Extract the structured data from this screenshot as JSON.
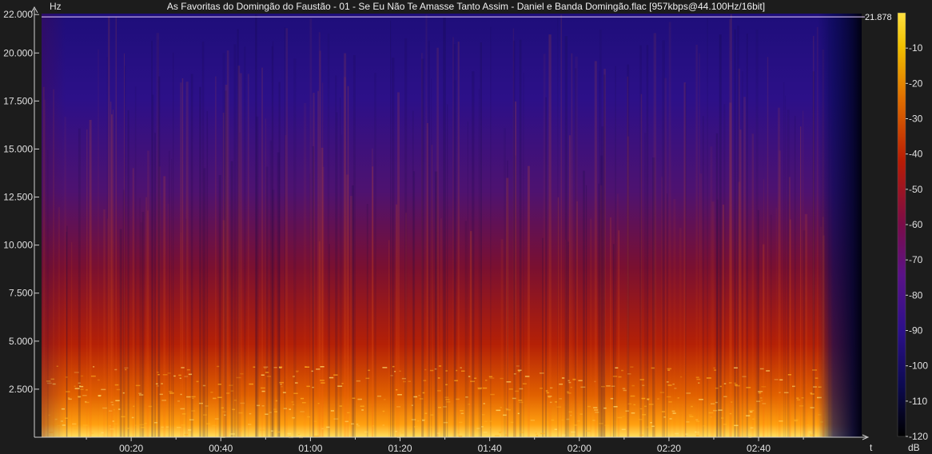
{
  "window": {
    "title": "As Favoritas do Domingão do Faustão - 01 - Se Eu Não Te Amasse Tanto Assim - Daniel e Banda Domingão.flac [957kbps@44.100Hz/16bit]"
  },
  "chart_data": {
    "type": "heatmap",
    "title": "As Favoritas do Domingão do Faustão - 01 - Se Eu Não Te Amasse Tanto Assim - Daniel e Banda Domingão.flac [957kbps@44.100Hz/16bit]",
    "ylabel": "Hz",
    "xlabel": "t",
    "colorbar_label": "dB",
    "y_ticks": [
      "22.000",
      "20.000",
      "17.500",
      "15.000",
      "12.500",
      "10.000",
      "7.500",
      "5.000",
      "2.500"
    ],
    "y_tick_values": [
      22000,
      20000,
      17500,
      15000,
      12500,
      10000,
      7500,
      5000,
      2500
    ],
    "x_ticks": [
      "00:20",
      "00:40",
      "01:00",
      "01:20",
      "01:40",
      "02:00",
      "02:20",
      "02:40"
    ],
    "x_tick_values": [
      20,
      40,
      60,
      80,
      100,
      120,
      140,
      160
    ],
    "xlim": [
      0,
      183
    ],
    "ylim": [
      0,
      22050
    ],
    "cutoff_label": "21.878",
    "cutoff_value": 21878,
    "colorbar_ticks": [
      "-10",
      "-20",
      "-30",
      "-40",
      "-50",
      "-60",
      "-70",
      "-80",
      "-90",
      "-100",
      "-110",
      "-120"
    ],
    "colorbar_values": [
      -10,
      -20,
      -30,
      -40,
      -50,
      -60,
      -70,
      -80,
      -90,
      -100,
      -110,
      -120
    ],
    "colorbar_range": [
      -120,
      0
    ],
    "colors": {
      "scale": [
        "#000000",
        "#0a0a5a",
        "#2a1290",
        "#4a148c",
        "#7a0c48",
        "#b01a08",
        "#e05a00",
        "#ff9e00",
        "#ffe040"
      ],
      "background": "#1c1c1c",
      "axis": "#d0d0d0",
      "cutoff_line": "#e8d0ff"
    }
  }
}
